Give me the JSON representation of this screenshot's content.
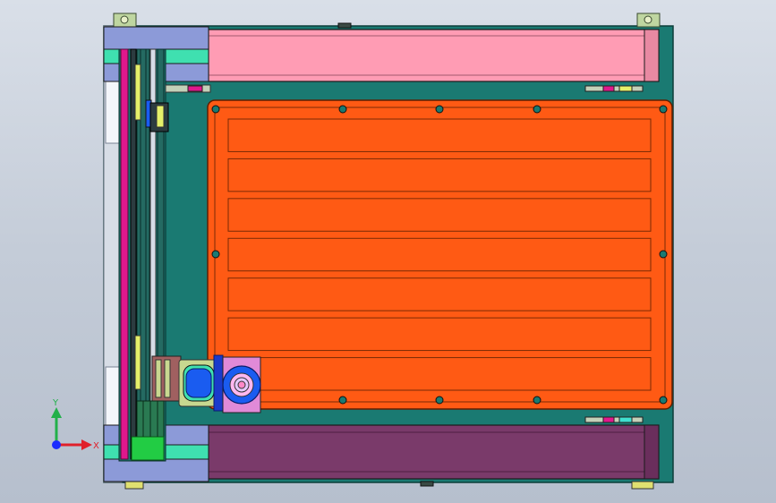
{
  "viewport": {
    "background_top": "#d9dfe8",
    "background_bottom": "#b6bfcd"
  },
  "colors": {
    "base_plate": "#1a7a72",
    "table_orange": "#ff5a14",
    "rail_pink": "#ff9cb4",
    "rail_purple": "#7a3a6a",
    "end_block_blue": "#8c9ad8",
    "accent_cyan": "#3fe0b0",
    "magenta_strip": "#e0188c",
    "motor_green": "#22cc44",
    "motor_blue": "#1a5cf0",
    "motor_pink": "#e08ad8",
    "carriage_olive": "#c8d890"
  },
  "triad": {
    "y_label": "Y",
    "x_label": "X",
    "y_color": "#22b04a",
    "x_color": "#e0202a",
    "z_color": "#1a2aff"
  },
  "table": {
    "slot_count": 7
  }
}
